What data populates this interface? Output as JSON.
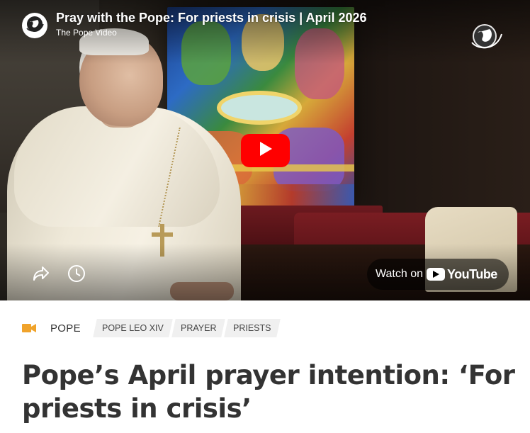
{
  "video": {
    "title": "Pray with the Pope: For priests in crisis | April 2026",
    "channel": "The Pope Video",
    "watch_on_label": "Watch on",
    "youtube_wordmark": "YouTube",
    "icons": {
      "channel": "globe-logo-icon",
      "corner": "globe-logo-icon",
      "play": "play-icon",
      "share": "share-icon",
      "watch_later": "clock-icon"
    },
    "colors": {
      "play_button": "#ff0000",
      "overlay_text": "#ffffff"
    }
  },
  "article": {
    "category_icon": "video-camera-icon",
    "category": "POPE",
    "tags": [
      "POPE LEO XIV",
      "PRAYER",
      "PRIESTS"
    ],
    "headline": "Pope’s April prayer intention: ‘For priests in crisis’",
    "colors": {
      "category_icon": "#f0a32b",
      "headline": "#333333",
      "tag_bg": "#f0f0f0"
    }
  }
}
